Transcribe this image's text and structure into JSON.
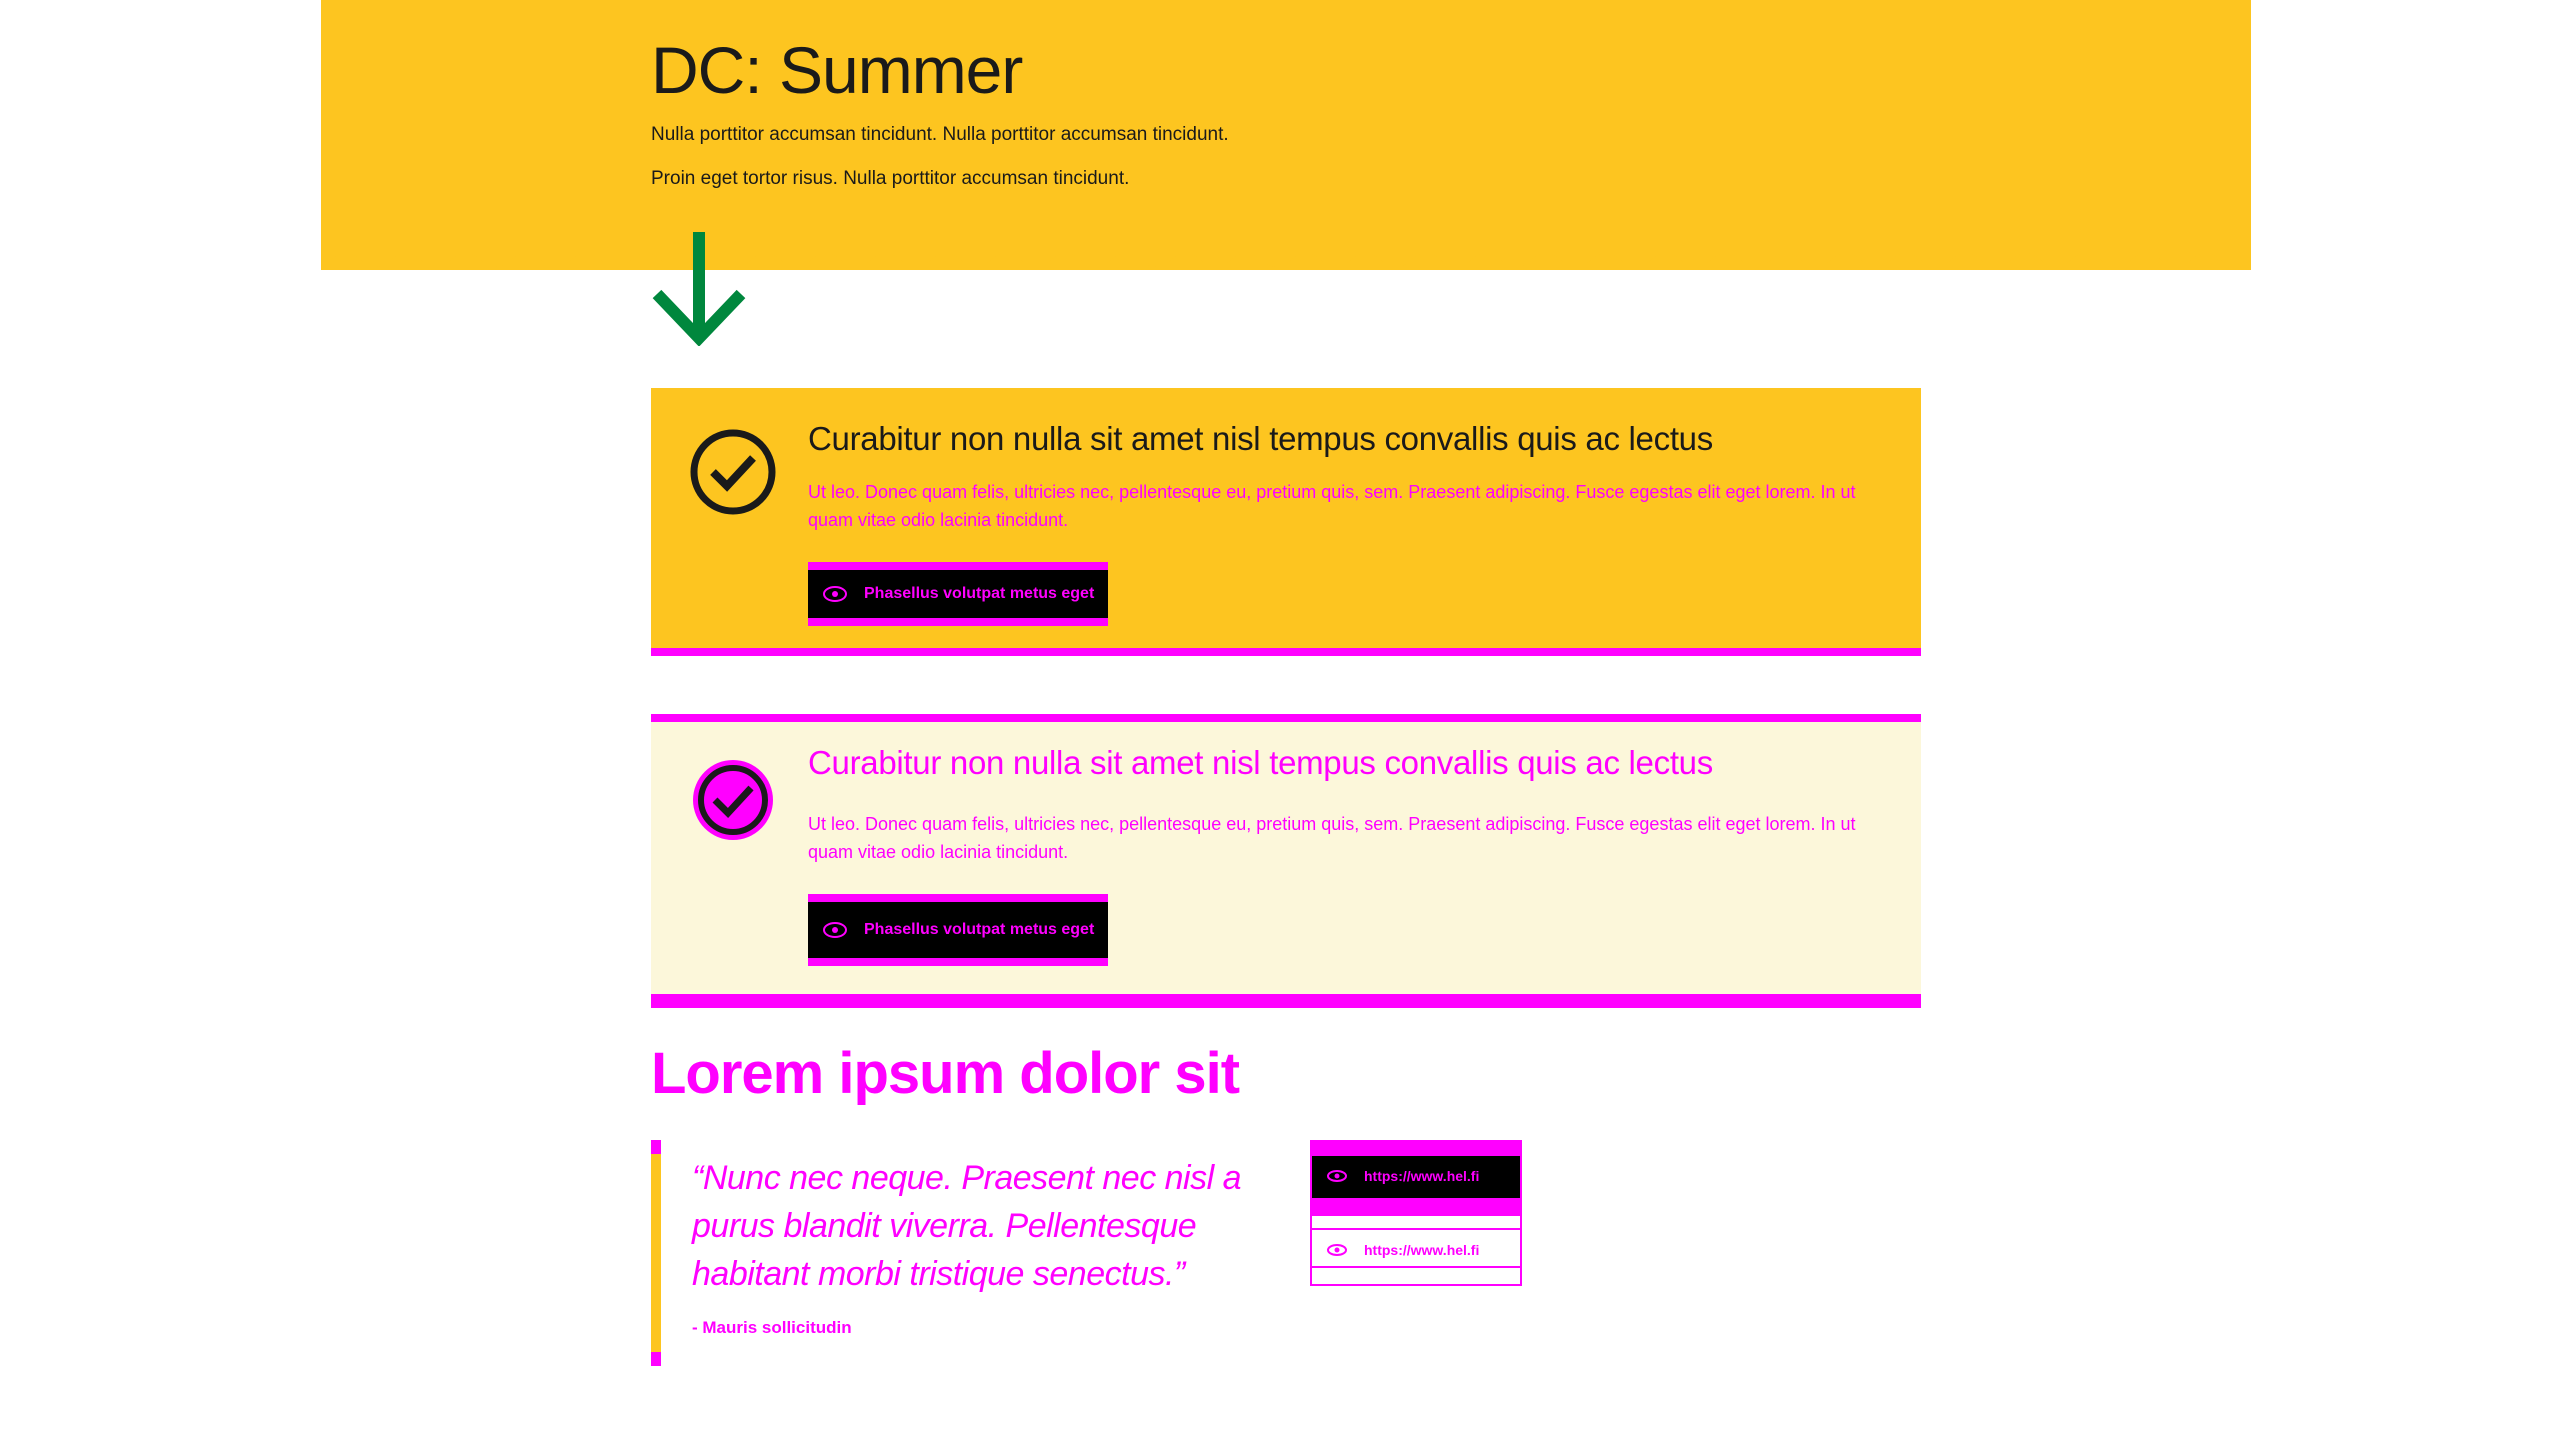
{
  "header": {
    "title": "DC: Summer",
    "lead1": "Nulla porttitor accumsan tincidunt. Nulla porttitor accumsan tincidunt.",
    "lead2": "Proin eget tortor risus. Nulla porttitor accumsan tincidunt."
  },
  "cards": [
    {
      "title": "Curabitur non nulla sit amet nisl tempus convallis quis ac lectus",
      "text": "Ut leo. Donec quam felis, ultricies nec, pellentesque eu, pretium quis, sem. Praesent adipiscing. Fusce egestas elit eget lorem. In ut quam vitae odio lacinia tincidunt.",
      "button_label": "Phasellus volutpat metus eget"
    },
    {
      "title": "Curabitur non nulla sit amet nisl tempus convallis quis ac lectus",
      "text": "Ut leo. Donec quam felis, ultricies nec, pellentesque eu, pretium quis, sem. Praesent adipiscing. Fusce egestas elit eget lorem. In ut quam vitae odio lacinia tincidunt.",
      "button_label": "Phasellus volutpat metus eget"
    }
  ],
  "section": {
    "title": "Lorem ipsum dolor sit",
    "quote": "“Nunc nec neque. Praesent nec nisl a purus blandit viverra. Pellentesque habitant morbi tristique senectus.”",
    "cite": "- Mauris sollicitudin"
  },
  "links": {
    "url": "https://www.hel.fi"
  },
  "colors": {
    "summer_yellow": "#fdc520",
    "highlight": "#ff00ff",
    "arrow_green": "#00873d",
    "light_yellow": "#fcf7da"
  },
  "icons": [
    "arrow-down-icon",
    "check-circle-icon",
    "eye-icon"
  ]
}
